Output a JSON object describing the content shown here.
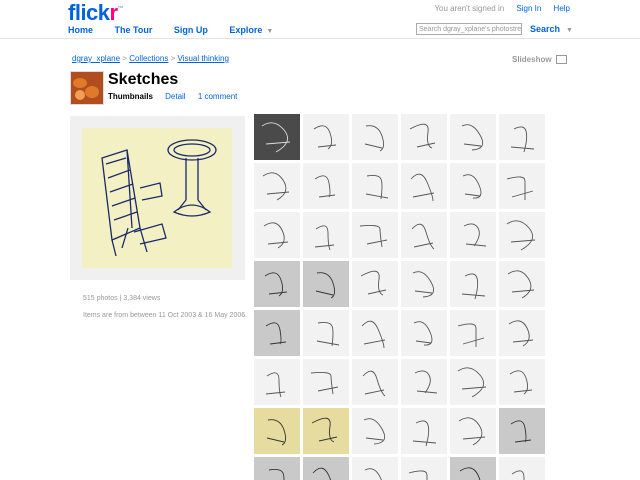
{
  "brand": {
    "logo_main": "flick",
    "logo_accent": "r",
    "logo_tm": "™"
  },
  "topright": {
    "status": "You aren't signed in",
    "signin": "Sign In",
    "help": "Help"
  },
  "nav": {
    "home": "Home",
    "tour": "The Tour",
    "signup": "Sign Up",
    "explore": "Explore"
  },
  "search": {
    "placeholder": "Search dgray_xplane's photostream",
    "button": "Search"
  },
  "breadcrumb": {
    "owner": "dgray_xplane",
    "collections": "Collections",
    "parent": "Visual thinking",
    "sep": ">"
  },
  "slideshow": {
    "label": "Slideshow"
  },
  "set": {
    "title": "Sketches",
    "tab_thumbnails": "Thumbnails",
    "tab_detail": "Detail",
    "tab_comment": "1 comment"
  },
  "stats": {
    "counts": "515 photos | 3,384 views",
    "dates": "Items are from between 11 Oct 2003 & 16 May 2006."
  },
  "thumbnails": {
    "columns": 6,
    "rows": 8,
    "tones": [
      "dark",
      "light",
      "light",
      "light",
      "light",
      "light",
      "light",
      "light",
      "light",
      "light",
      "light",
      "light",
      "light",
      "light",
      "light",
      "light",
      "light",
      "light",
      "gray",
      "gray",
      "light",
      "light",
      "light",
      "light",
      "gray",
      "light",
      "light",
      "light",
      "light",
      "light",
      "light",
      "light",
      "light",
      "light",
      "light",
      "light",
      "yellow",
      "yellow",
      "light",
      "light",
      "light",
      "gray",
      "gray",
      "gray",
      "light",
      "light",
      "gray",
      "light"
    ]
  },
  "colors": {
    "link": "#0063dc",
    "accent": "#ff0084",
    "muted": "#999999"
  }
}
